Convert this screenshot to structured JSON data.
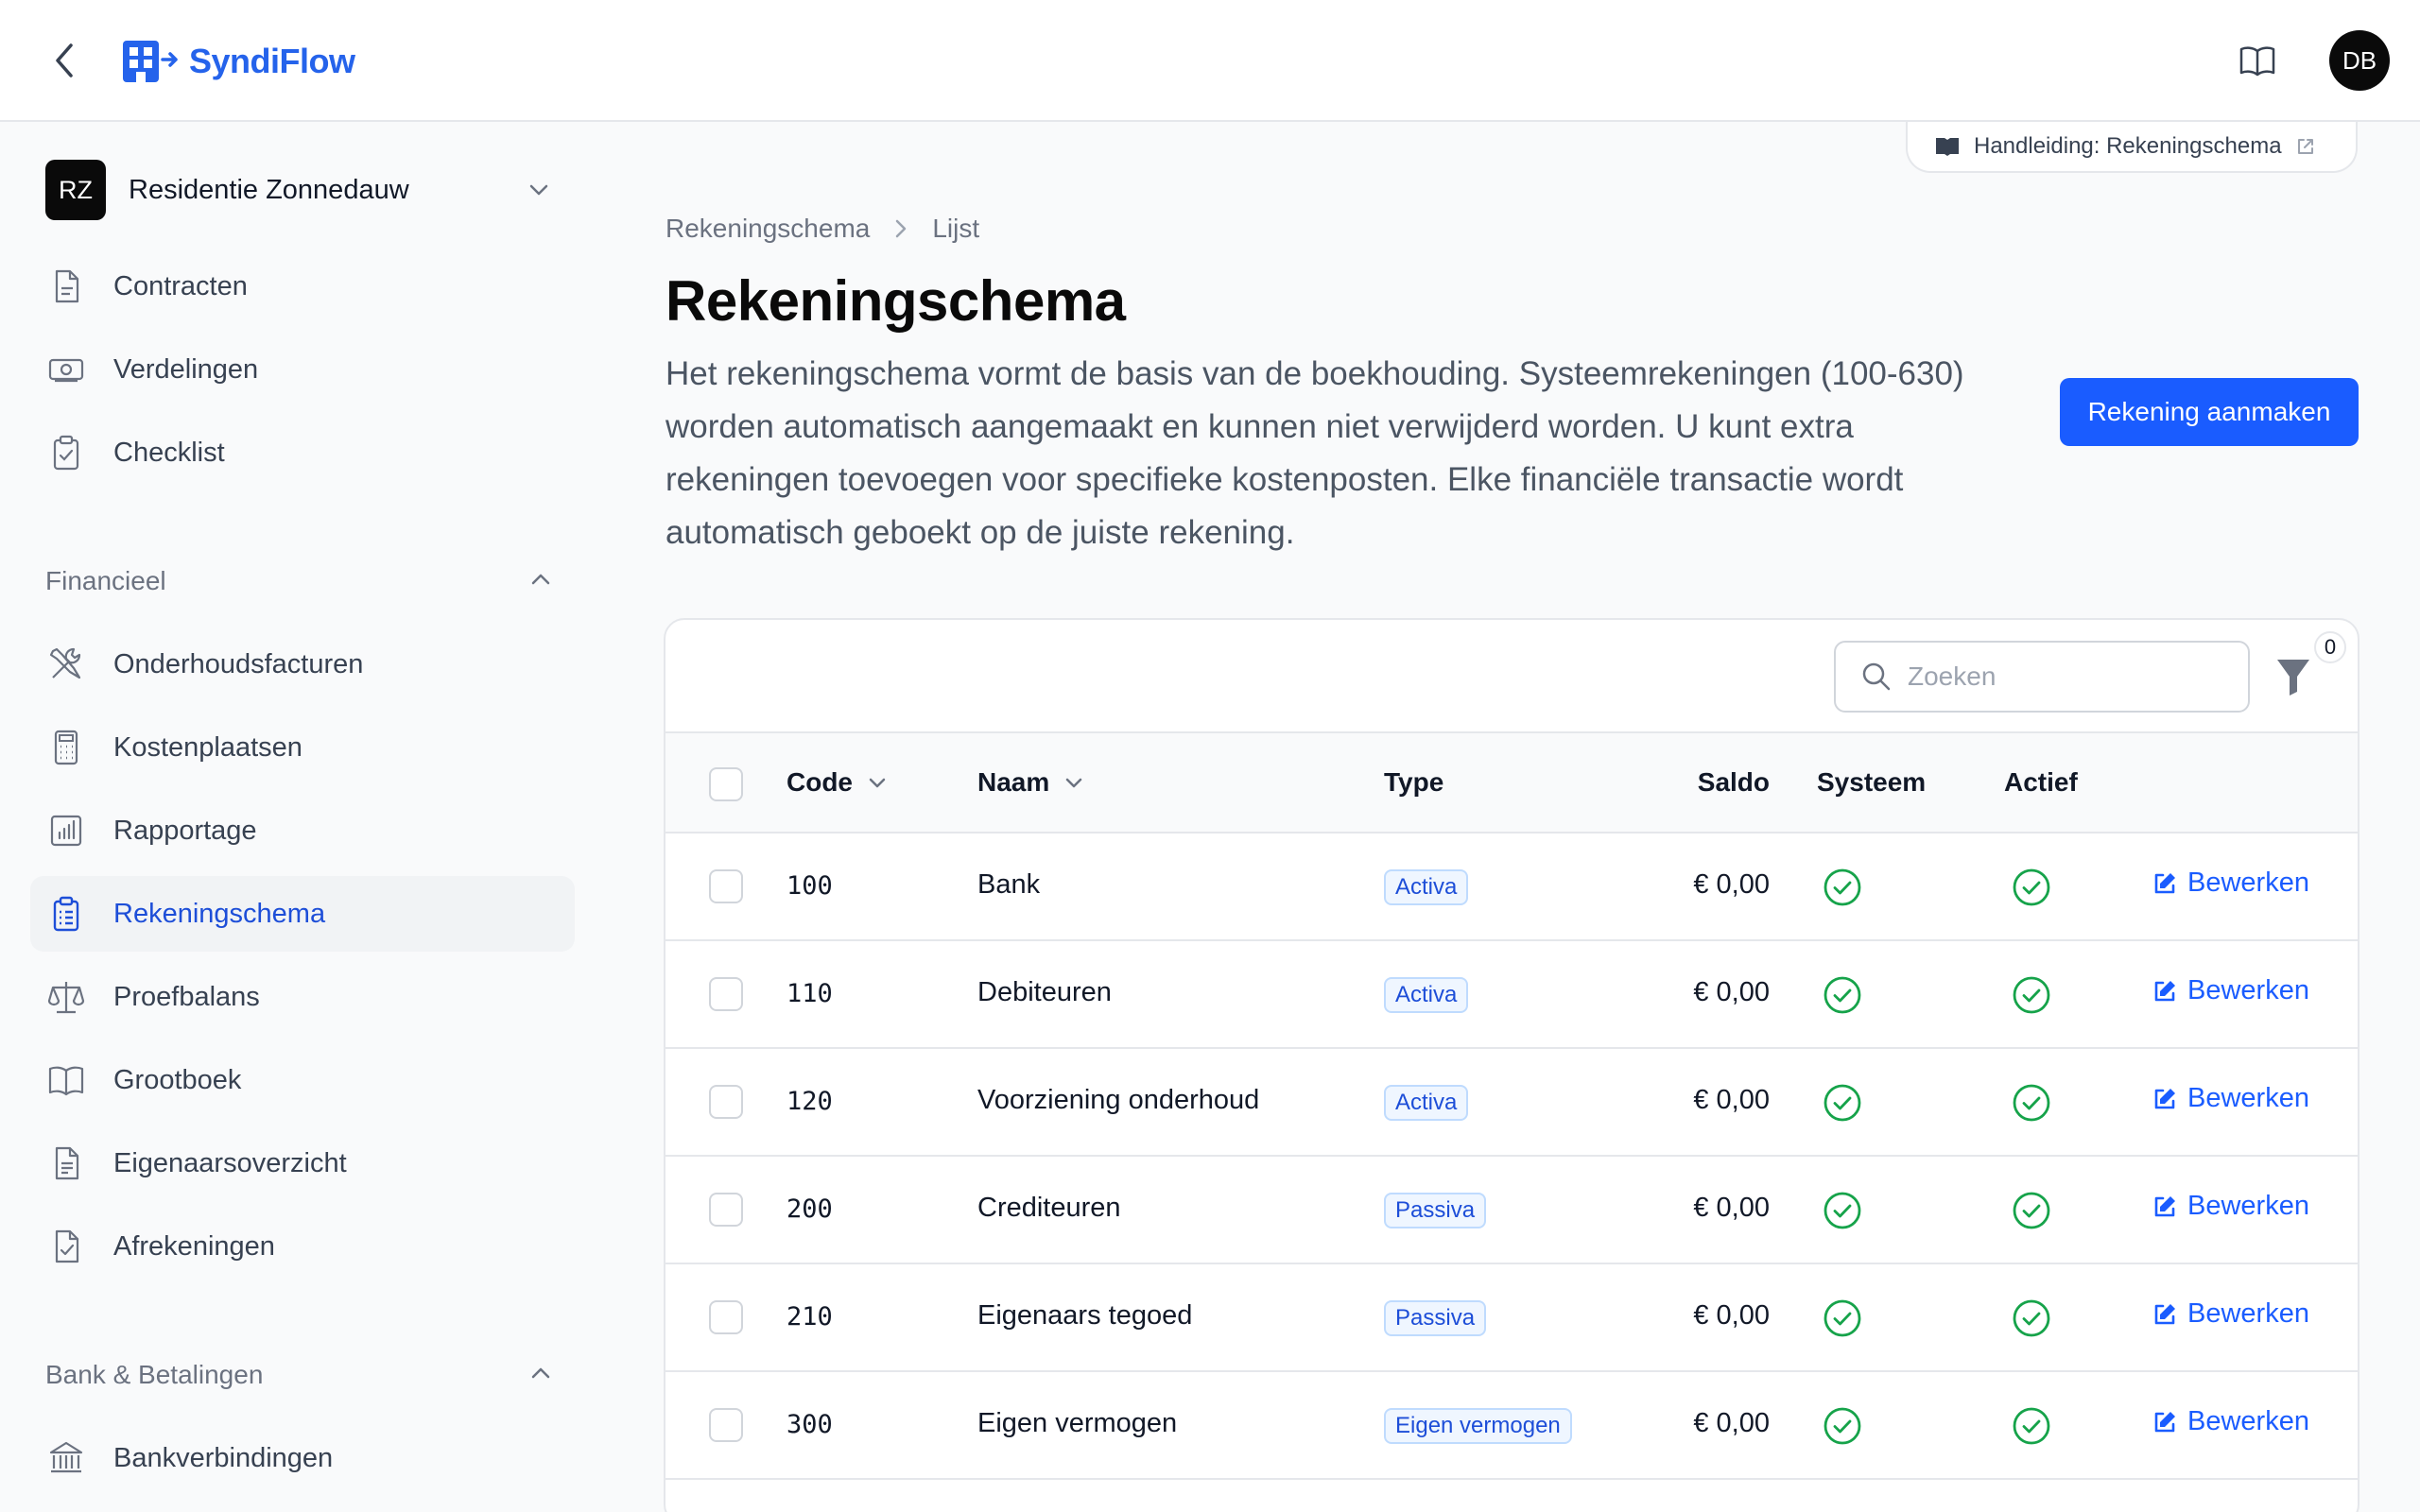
{
  "app": {
    "brand": "SyndiFlow",
    "user_initials": "DB",
    "back_icon": "chevron-left-icon",
    "manual_icon": "book-open-icon"
  },
  "sidebar": {
    "tenant": {
      "initials": "RZ",
      "name": "Residentie Zonnedauw"
    },
    "top_items": [
      {
        "label": "Contracten",
        "icon": "document-icon"
      },
      {
        "label": "Verdelingen",
        "icon": "banknote-icon"
      },
      {
        "label": "Checklist",
        "icon": "clipboard-check-icon"
      }
    ],
    "groups": [
      {
        "label": "Financieel",
        "expanded": true,
        "items": [
          {
            "label": "Onderhoudsfacturen",
            "icon": "wrench-screwdriver-icon"
          },
          {
            "label": "Kostenplaatsen",
            "icon": "calculator-icon"
          },
          {
            "label": "Rapportage",
            "icon": "bar-chart-icon"
          },
          {
            "label": "Rekeningschema",
            "icon": "clipboard-list-icon",
            "active": true
          },
          {
            "label": "Proefbalans",
            "icon": "scale-icon"
          },
          {
            "label": "Grootboek",
            "icon": "book-open-icon"
          },
          {
            "label": "Eigenaarsoverzicht",
            "icon": "document-text-icon"
          },
          {
            "label": "Afrekeningen",
            "icon": "document-check-icon"
          }
        ]
      },
      {
        "label": "Bank & Betalingen",
        "expanded": true,
        "items": [
          {
            "label": "Bankverbindingen",
            "icon": "bank-icon"
          }
        ]
      }
    ]
  },
  "main": {
    "manual_link": "Handleiding: Rekeningschema",
    "breadcrumb": [
      "Rekeningschema",
      "Lijst"
    ],
    "title": "Rekeningschema",
    "description": "Het rekeningschema vormt de basis van de boekhouding. Systeemrekeningen (100-630) worden automatisch aangemaakt en kunnen niet verwijderd worden. U kunt extra rekeningen toevoegen voor specifieke kostenposten. Elke financiële transactie wordt automatisch geboekt op de juiste rekening.",
    "create_button": "Rekening aanmaken"
  },
  "table": {
    "search_placeholder": "Zoeken",
    "filter_count": "0",
    "columns": {
      "code": "Code",
      "naam": "Naam",
      "type": "Type",
      "saldo": "Saldo",
      "systeem": "Systeem",
      "actief": "Actief"
    },
    "edit_label": "Bewerken",
    "rows": [
      {
        "code": "100",
        "naam": "Bank",
        "type": "Activa",
        "saldo": "€ 0,00",
        "systeem": true,
        "actief": true
      },
      {
        "code": "110",
        "naam": "Debiteuren",
        "type": "Activa",
        "saldo": "€ 0,00",
        "systeem": true,
        "actief": true
      },
      {
        "code": "120",
        "naam": "Voorziening onderhoud",
        "type": "Activa",
        "saldo": "€ 0,00",
        "systeem": true,
        "actief": true
      },
      {
        "code": "200",
        "naam": "Crediteuren",
        "type": "Passiva",
        "saldo": "€ 0,00",
        "systeem": true,
        "actief": true
      },
      {
        "code": "210",
        "naam": "Eigenaars tegoed",
        "type": "Passiva",
        "saldo": "€ 0,00",
        "systeem": true,
        "actief": true
      },
      {
        "code": "300",
        "naam": "Eigen vermogen",
        "type": "Eigen vermogen",
        "saldo": "€ 0,00",
        "systeem": true,
        "actief": true
      }
    ]
  },
  "colors": {
    "accent": "#1a5cff",
    "active_nav_text": "#1d4ed8",
    "check_green": "#16a34a",
    "badge_bg": "#eff6ff",
    "badge_border": "#bfdbfe"
  }
}
